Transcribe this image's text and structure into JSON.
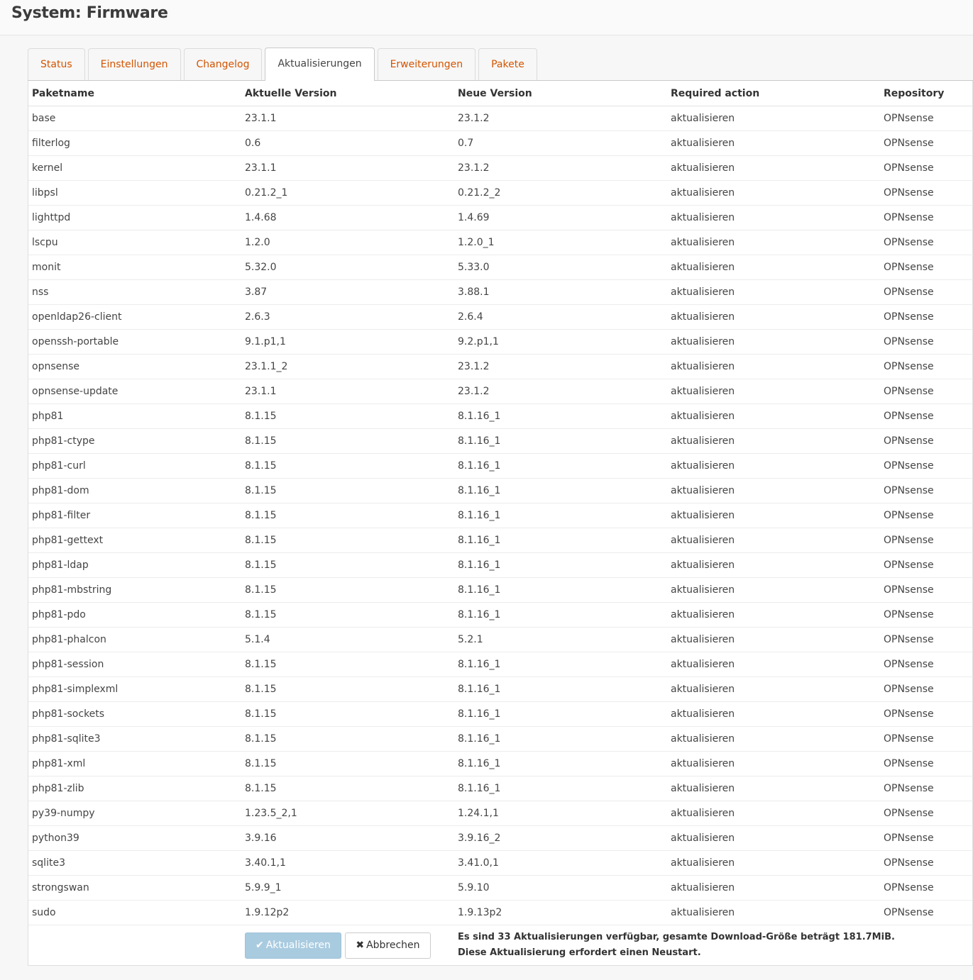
{
  "page": {
    "title": "System: Firmware"
  },
  "tabs": [
    {
      "label": "Status"
    },
    {
      "label": "Einstellungen"
    },
    {
      "label": "Changelog"
    },
    {
      "label": "Aktualisierungen"
    },
    {
      "label": "Erweiterungen"
    },
    {
      "label": "Pakete"
    }
  ],
  "active_tab": "Aktualisierungen",
  "table": {
    "headers": [
      "Paketname",
      "Aktuelle Version",
      "Neue Version",
      "Required action",
      "Repository"
    ],
    "rows": [
      [
        "base",
        "23.1.1",
        "23.1.2",
        "aktualisieren",
        "OPNsense"
      ],
      [
        "filterlog",
        "0.6",
        "0.7",
        "aktualisieren",
        "OPNsense"
      ],
      [
        "kernel",
        "23.1.1",
        "23.1.2",
        "aktualisieren",
        "OPNsense"
      ],
      [
        "libpsl",
        "0.21.2_1",
        "0.21.2_2",
        "aktualisieren",
        "OPNsense"
      ],
      [
        "lighttpd",
        "1.4.68",
        "1.4.69",
        "aktualisieren",
        "OPNsense"
      ],
      [
        "lscpu",
        "1.2.0",
        "1.2.0_1",
        "aktualisieren",
        "OPNsense"
      ],
      [
        "monit",
        "5.32.0",
        "5.33.0",
        "aktualisieren",
        "OPNsense"
      ],
      [
        "nss",
        "3.87",
        "3.88.1",
        "aktualisieren",
        "OPNsense"
      ],
      [
        "openldap26-client",
        "2.6.3",
        "2.6.4",
        "aktualisieren",
        "OPNsense"
      ],
      [
        "openssh-portable",
        "9.1.p1,1",
        "9.2.p1,1",
        "aktualisieren",
        "OPNsense"
      ],
      [
        "opnsense",
        "23.1.1_2",
        "23.1.2",
        "aktualisieren",
        "OPNsense"
      ],
      [
        "opnsense-update",
        "23.1.1",
        "23.1.2",
        "aktualisieren",
        "OPNsense"
      ],
      [
        "php81",
        "8.1.15",
        "8.1.16_1",
        "aktualisieren",
        "OPNsense"
      ],
      [
        "php81-ctype",
        "8.1.15",
        "8.1.16_1",
        "aktualisieren",
        "OPNsense"
      ],
      [
        "php81-curl",
        "8.1.15",
        "8.1.16_1",
        "aktualisieren",
        "OPNsense"
      ],
      [
        "php81-dom",
        "8.1.15",
        "8.1.16_1",
        "aktualisieren",
        "OPNsense"
      ],
      [
        "php81-filter",
        "8.1.15",
        "8.1.16_1",
        "aktualisieren",
        "OPNsense"
      ],
      [
        "php81-gettext",
        "8.1.15",
        "8.1.16_1",
        "aktualisieren",
        "OPNsense"
      ],
      [
        "php81-ldap",
        "8.1.15",
        "8.1.16_1",
        "aktualisieren",
        "OPNsense"
      ],
      [
        "php81-mbstring",
        "8.1.15",
        "8.1.16_1",
        "aktualisieren",
        "OPNsense"
      ],
      [
        "php81-pdo",
        "8.1.15",
        "8.1.16_1",
        "aktualisieren",
        "OPNsense"
      ],
      [
        "php81-phalcon",
        "5.1.4",
        "5.2.1",
        "aktualisieren",
        "OPNsense"
      ],
      [
        "php81-session",
        "8.1.15",
        "8.1.16_1",
        "aktualisieren",
        "OPNsense"
      ],
      [
        "php81-simplexml",
        "8.1.15",
        "8.1.16_1",
        "aktualisieren",
        "OPNsense"
      ],
      [
        "php81-sockets",
        "8.1.15",
        "8.1.16_1",
        "aktualisieren",
        "OPNsense"
      ],
      [
        "php81-sqlite3",
        "8.1.15",
        "8.1.16_1",
        "aktualisieren",
        "OPNsense"
      ],
      [
        "php81-xml",
        "8.1.15",
        "8.1.16_1",
        "aktualisieren",
        "OPNsense"
      ],
      [
        "php81-zlib",
        "8.1.15",
        "8.1.16_1",
        "aktualisieren",
        "OPNsense"
      ],
      [
        "py39-numpy",
        "1.23.5_2,1",
        "1.24.1,1",
        "aktualisieren",
        "OPNsense"
      ],
      [
        "python39",
        "3.9.16",
        "3.9.16_2",
        "aktualisieren",
        "OPNsense"
      ],
      [
        "sqlite3",
        "3.40.1,1",
        "3.41.0,1",
        "aktualisieren",
        "OPNsense"
      ],
      [
        "strongswan",
        "5.9.9_1",
        "5.9.10",
        "aktualisieren",
        "OPNsense"
      ],
      [
        "sudo",
        "1.9.12p2",
        "1.9.13p2",
        "aktualisieren",
        "OPNsense"
      ]
    ]
  },
  "footer": {
    "update_button": {
      "label": "Aktualisieren",
      "icon": "check-icon"
    },
    "cancel_button": {
      "label": "Abbrechen",
      "icon": "close-icon"
    },
    "info_line1": "Es sind 33 Aktualisierungen verfügbar, gesamte Download-Größe beträgt 181.7MiB.",
    "info_line2": "Diese Aktualisierung erfordert einen Neustart."
  },
  "colors": {
    "accent": "#d35400",
    "primary_button": "#a9cbe0"
  }
}
